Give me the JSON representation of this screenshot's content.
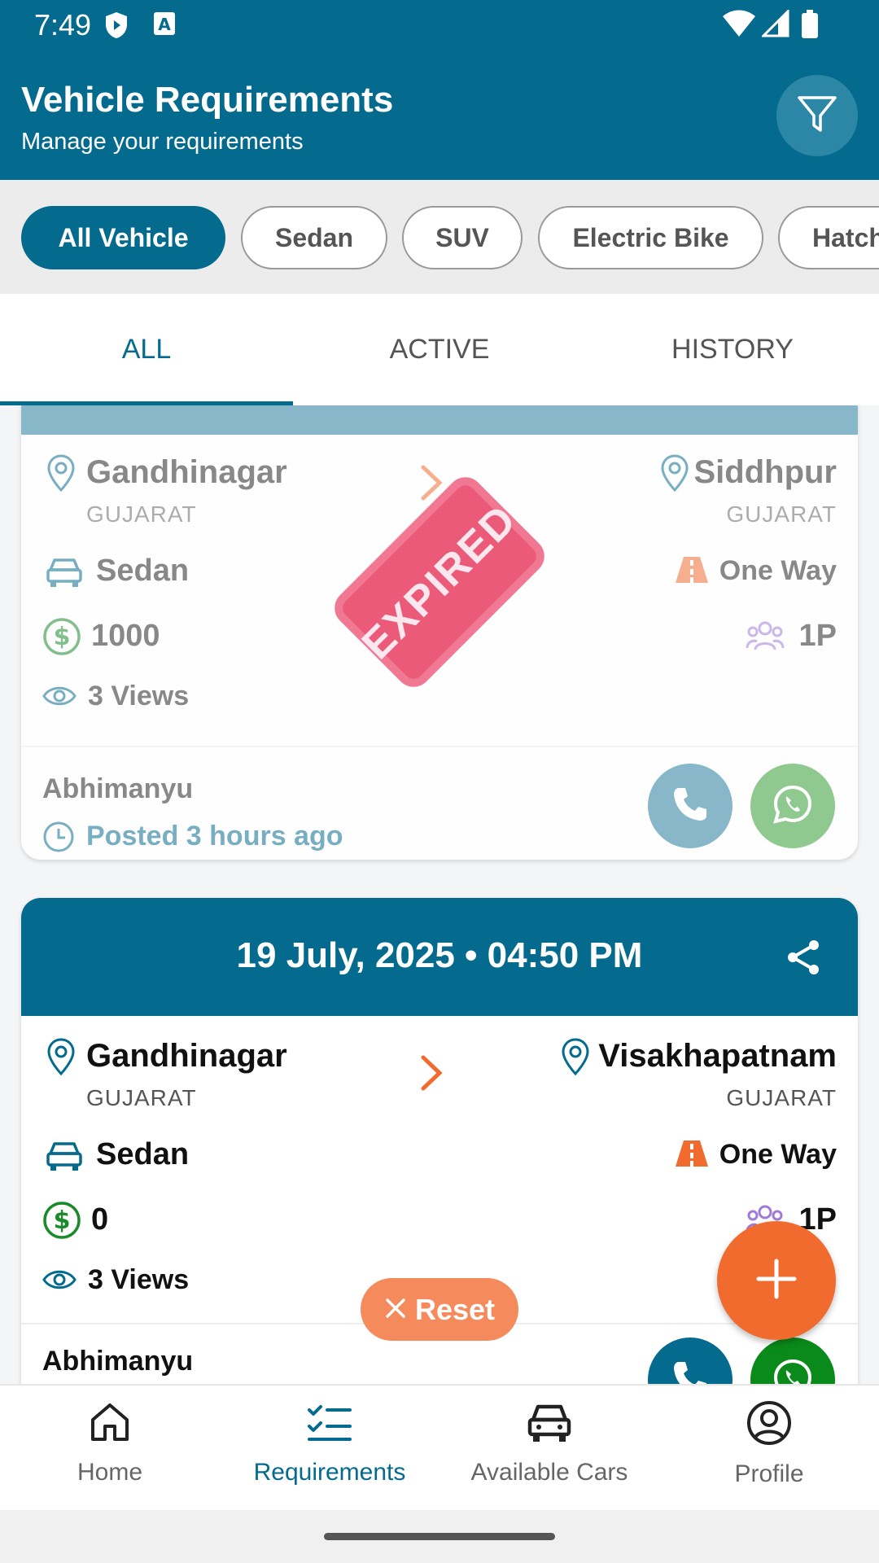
{
  "status_bar": {
    "time": "7:49"
  },
  "app_bar": {
    "title": "Vehicle Requirements",
    "subtitle": "Manage your requirements"
  },
  "chips": [
    "All Vehicle",
    "Sedan",
    "SUV",
    "Electric Bike",
    "Hatch"
  ],
  "tabs": [
    "ALL",
    "ACTIVE",
    "HISTORY"
  ],
  "cards": [
    {
      "status": "EXPIRED",
      "from_city": "Gandhinagar",
      "from_state": "GUJARAT",
      "to_city": "Siddhpur",
      "to_state": "GUJARAT",
      "vehicle": "Sedan",
      "trip_type": "One Way",
      "price": "1000",
      "passengers": "1P",
      "views": "3 Views",
      "poster": "Abhimanyu",
      "posted": "Posted 3 hours ago"
    },
    {
      "date": "19 July, 2025 • 04:50 PM",
      "from_city": "Gandhinagar",
      "from_state": "GUJARAT",
      "to_city": "Visakhapatnam",
      "to_state": "GUJARAT",
      "vehicle": "Sedan",
      "trip_type": "One Way",
      "price": "0",
      "passengers": "1P",
      "views": "3 Views",
      "poster": "Abhimanyu"
    }
  ],
  "reset_label": "Reset",
  "bottom_nav": [
    "Home",
    "Requirements",
    "Available Cars",
    "Profile"
  ],
  "colors": {
    "primary": "#046a8e",
    "accent": "#f26b2e",
    "money_green": "#1a8a2a",
    "whatsapp": "#0a8a1a"
  }
}
